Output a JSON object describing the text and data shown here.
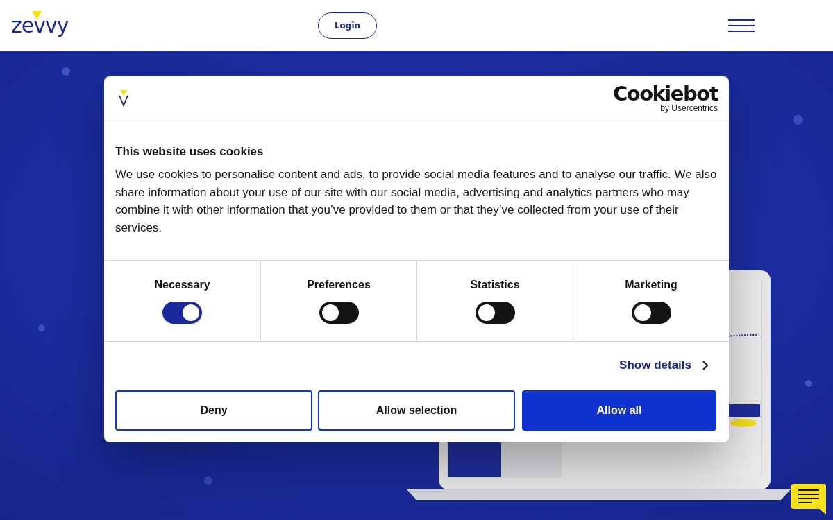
{
  "header": {
    "logo": "zevvy",
    "login_button": "Login"
  },
  "cookie_dialog": {
    "brand": {
      "name": "Cookiebot",
      "byline": "by Usercentrics"
    },
    "title": "This website uses cookies",
    "body": "We use cookies to personalise content and ads, to provide social media features and to analyse our traffic. We also share information about your use of our site with our social media, advertising and analytics partners who may combine it with other information that you’ve provided to them or that they’ve collected from your use of their services.",
    "categories": [
      {
        "label": "Necessary",
        "checked": true
      },
      {
        "label": "Preferences",
        "checked": false
      },
      {
        "label": "Statistics",
        "checked": false
      },
      {
        "label": "Marketing",
        "checked": false
      }
    ],
    "details_link": "Show details",
    "buttons": [
      {
        "label": "Deny",
        "kind": "outline"
      },
      {
        "label": "Allow selection",
        "kind": "outline"
      },
      {
        "label": "Allow all",
        "kind": "primary"
      }
    ]
  }
}
